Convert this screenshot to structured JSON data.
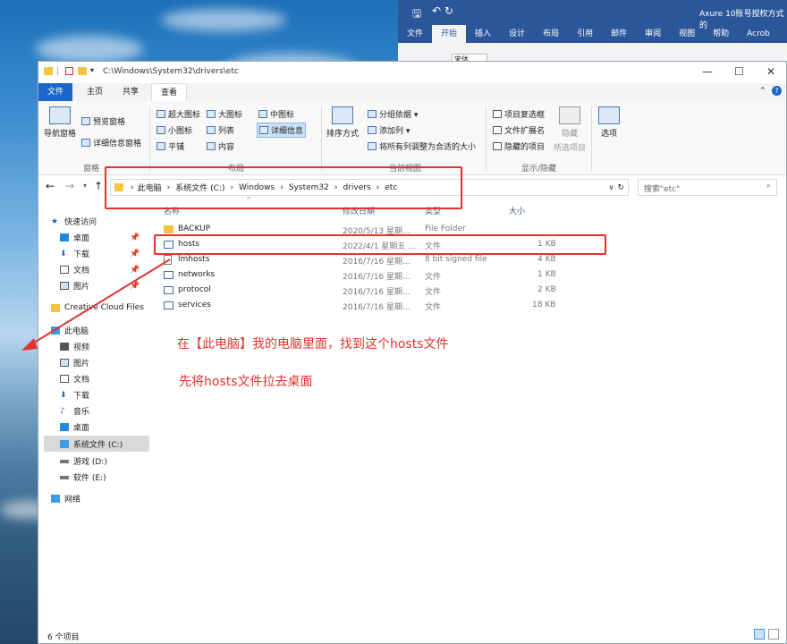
{
  "word": {
    "app_title": "Axure 10账号授权方式的",
    "tabs": [
      "文件",
      "开始",
      "插入",
      "设计",
      "布局",
      "引用",
      "邮件",
      "审阅",
      "视图",
      "帮助",
      "Acrob"
    ],
    "font_name": "宋体"
  },
  "explorer": {
    "path_title": "C:\\Windows\\System32\\drivers\\etc",
    "ribbon_tabs": [
      "文件",
      "主页",
      "共享",
      "查看"
    ],
    "ribbon": {
      "nav_pane": "导航窗格",
      "preview_pane": "预览窗格",
      "details_pane": "详细信息窗格",
      "pane_group": "窗格",
      "layout": [
        "超大图标",
        "大图标",
        "中图标",
        "小图标",
        "列表",
        "详细信息",
        "平铺",
        "内容"
      ],
      "layout_group": "布局",
      "sort_by": "排序方式",
      "group_by": "分组依据 ▾",
      "add_columns": "添加列 ▾",
      "fit_columns": "将所有列调整为合适的大小",
      "view_group": "当前视图",
      "item_checkboxes": "项目复选框",
      "file_extensions": "文件扩展名",
      "hidden_items": "隐藏的项目",
      "hide_selected": "隐藏\n所选项目",
      "hide_label": "隐藏",
      "selected_label": "所选项目",
      "options": "选项",
      "showhide_group": "显示/隐藏"
    },
    "breadcrumb": [
      "此电脑",
      "系统文件 (C:)",
      "Windows",
      "System32",
      "drivers",
      "etc"
    ],
    "search_placeholder": "搜索\"etc\"",
    "columns": {
      "name": "名称",
      "date": "修改日期",
      "type": "类型",
      "size": "大小"
    },
    "files": [
      {
        "name": "BACKUP",
        "date": "2020/5/13 星期...",
        "type": "File Folder",
        "size": ""
      },
      {
        "name": "hosts",
        "date": "2022/4/1 星期五 ...",
        "type": "文件",
        "size": "1 KB"
      },
      {
        "name": "lmhosts",
        "date": "2016/7/16 星期...",
        "type": "8 bit signed file",
        "size": "4 KB"
      },
      {
        "name": "networks",
        "date": "2016/7/16 星期...",
        "type": "文件",
        "size": "1 KB"
      },
      {
        "name": "protocol",
        "date": "2016/7/16 星期...",
        "type": "文件",
        "size": "2 KB"
      },
      {
        "name": "services",
        "date": "2016/7/16 星期...",
        "type": "文件",
        "size": "18 KB"
      }
    ],
    "sidebar": {
      "quick_access": "快速访问",
      "quick": [
        "桌面",
        "下载",
        "文档",
        "图片"
      ],
      "creative_cloud": "Creative Cloud Files",
      "this_pc": "此电脑",
      "pc": [
        "视频",
        "图片",
        "文档",
        "下载",
        "音乐",
        "桌面",
        "系统文件 (C:)",
        "游戏 (D:)",
        "软件 (E:)"
      ],
      "network": "网络"
    },
    "status": "6 个项目"
  },
  "annotations": {
    "line1": "在【此电脑】我的电脑里面，找到这个hosts文件",
    "line2": "先将hosts文件拉去桌面"
  },
  "colors": {
    "accent": "#1a66c9",
    "annotation": "#e5322d",
    "word": "#2b579a"
  }
}
